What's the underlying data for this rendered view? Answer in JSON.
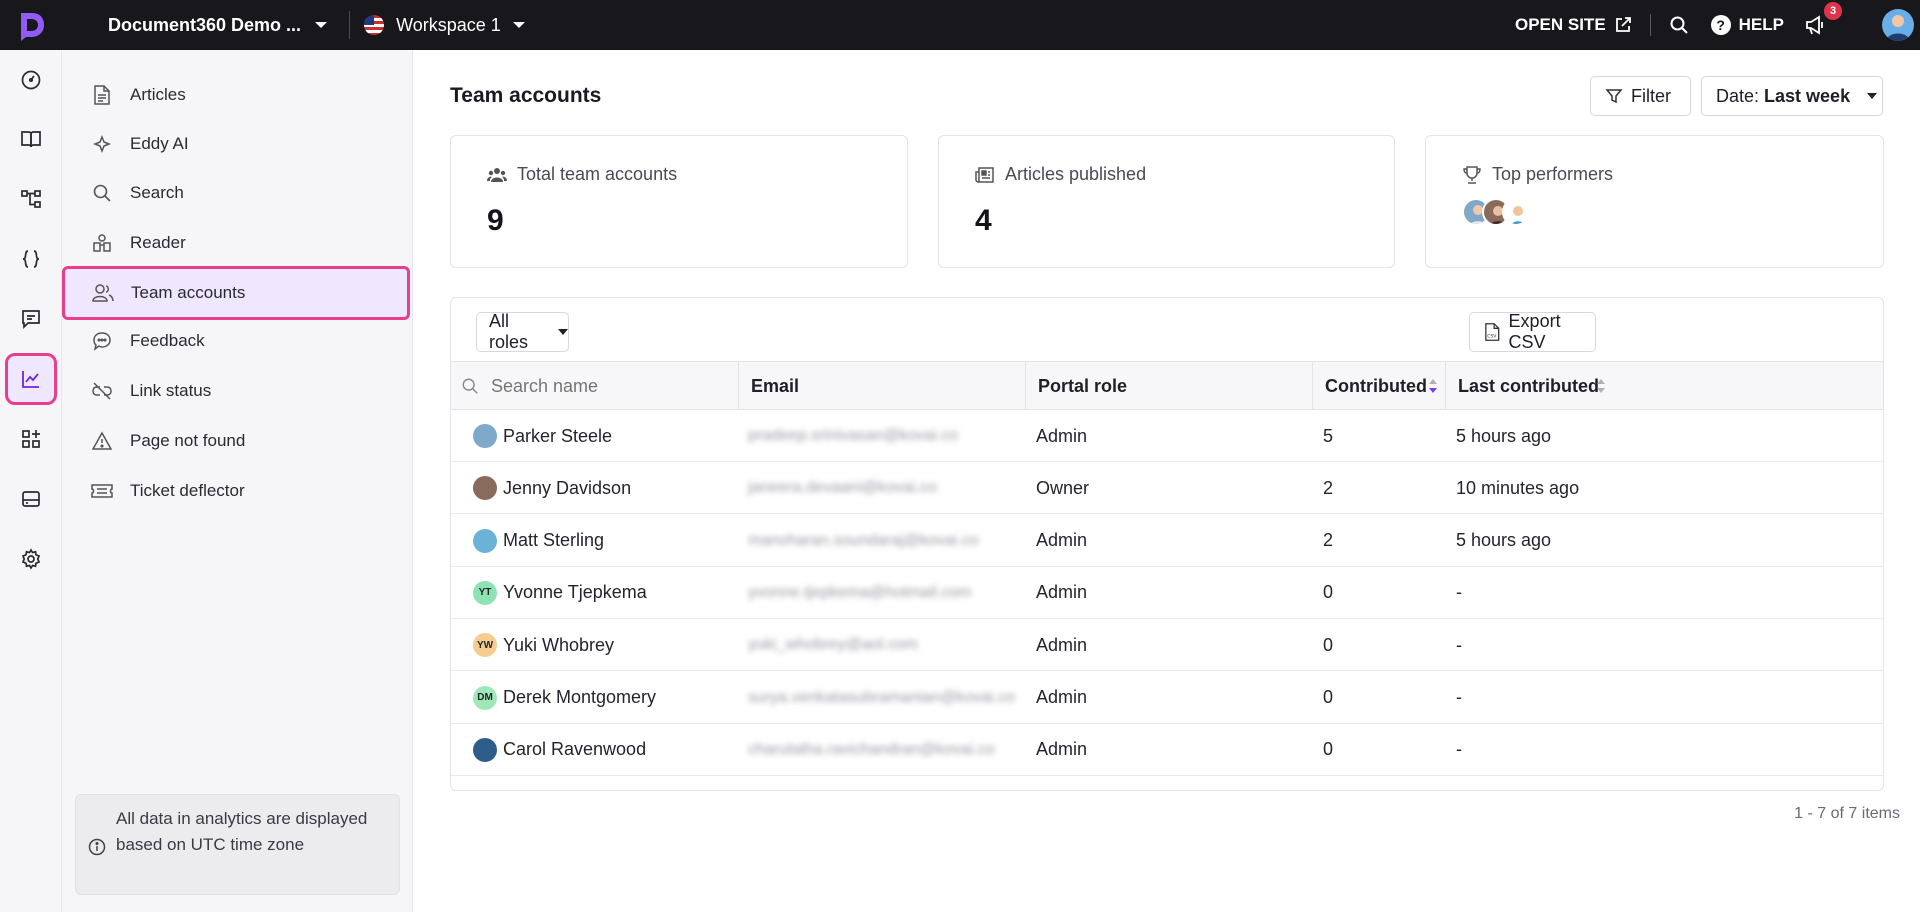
{
  "topbar": {
    "project_name": "Document360 Demo ...",
    "workspace": "Workspace 1",
    "open_site": "OPEN SITE",
    "help": "HELP",
    "notifications_count": "3",
    "icons": [
      "document360-logo-icon",
      "chevron-down-icon",
      "us-flag-icon",
      "external-link-icon",
      "search-icon",
      "help-icon",
      "megaphone-icon",
      "user-avatar"
    ]
  },
  "rail": {
    "items": [
      "dashboard-icon",
      "book-icon",
      "hierarchy-icon",
      "code-braces-icon",
      "chat-icon",
      "analytics-icon",
      "widgets-icon",
      "drive-icon",
      "settings-icon"
    ],
    "active": "analytics-icon"
  },
  "sidebar": {
    "items": [
      {
        "label": "Articles",
        "icon": "document-icon"
      },
      {
        "label": "Eddy AI",
        "icon": "sparkle-icon"
      },
      {
        "label": "Search",
        "icon": "search-icon"
      },
      {
        "label": "Reader",
        "icon": "reader-icon"
      },
      {
        "label": "Team accounts",
        "icon": "team-icon"
      },
      {
        "label": "Feedback",
        "icon": "feedback-icon"
      },
      {
        "label": "Link status",
        "icon": "broken-link-icon"
      },
      {
        "label": "Page not found",
        "icon": "warning-icon"
      },
      {
        "label": "Ticket deflector",
        "icon": "ticket-icon"
      }
    ],
    "active_index": 4,
    "note": "All data in analytics are displayed based on UTC time zone"
  },
  "main": {
    "title": "Team accounts",
    "filter_label": "Filter",
    "date_prefix": "Date:",
    "date_value": "Last week",
    "cards": {
      "total_label": "Total team accounts",
      "total_value": "9",
      "articles_label": "Articles published",
      "articles_value": "4",
      "top_label": "Top performers"
    },
    "roles_select": "All roles",
    "export_label": "Export CSV",
    "search_placeholder": "Search name",
    "columns": {
      "email": "Email",
      "role": "Portal role",
      "contributed": "Contributed",
      "last": "Last contributed"
    },
    "rows": [
      {
        "name": "Parker Steele",
        "initials": "",
        "avatar_color": "#7fa8c9",
        "email": "pradeep.srinivasan@kovai.co",
        "role": "Admin",
        "contributed": "5",
        "last": "5 hours ago"
      },
      {
        "name": "Jenny Davidson",
        "initials": "",
        "avatar_color": "#8a6a5a",
        "email": "janeera.devaani@kovai.co",
        "role": "Owner",
        "contributed": "2",
        "last": "10 minutes ago"
      },
      {
        "name": "Matt Sterling",
        "initials": "",
        "avatar_color": "#6bb3d6",
        "email": "manoharan.soundaraj@kovai.co",
        "role": "Admin",
        "contributed": "2",
        "last": "5 hours ago"
      },
      {
        "name": "Yvonne Tjepkema",
        "initials": "YT",
        "avatar_color": "#8ee3b5",
        "email": "yvonne.tjepkema@hotmail.com",
        "role": "Admin",
        "contributed": "0",
        "last": "-"
      },
      {
        "name": "Yuki Whobrey",
        "initials": "YW",
        "avatar_color": "#f7cc8f",
        "email": "yuki_whobrey@aol.com",
        "role": "Admin",
        "contributed": "0",
        "last": "-"
      },
      {
        "name": "Derek Montgomery",
        "initials": "DM",
        "avatar_color": "#9ee8b8",
        "email": "surya.venkatasubramanian@kovai.co",
        "role": "Admin",
        "contributed": "0",
        "last": "-"
      },
      {
        "name": "Carol Ravenwood",
        "initials": "",
        "avatar_color": "#2e5d8a",
        "email": "charulatha.ravichandran@kovai.co",
        "role": "Admin",
        "contributed": "0",
        "last": "-"
      }
    ],
    "pagination": "1 - 7 of 7 items"
  },
  "colors": {
    "accent": "#7c3aed",
    "highlight_border": "#e83e8c",
    "topbar_bg": "#18181c",
    "badge": "#e0344d"
  }
}
